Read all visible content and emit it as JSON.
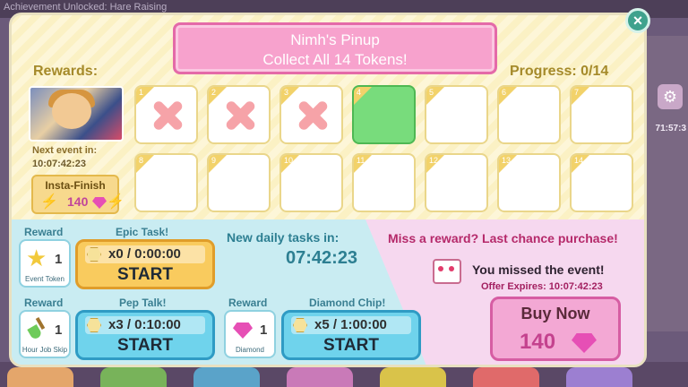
{
  "background": {
    "achievement_text": "Achievement Unlocked: Hare Raising",
    "side_timer": "71:57:3",
    "gear_icon": "gear-icon"
  },
  "modal": {
    "title_line1": "Nimh's Pinup",
    "title_line2": "Collect All 14 Tokens!",
    "close_label": "×",
    "rewards_label": "Rewards:",
    "progress_label": "Progress: 0/14",
    "next_event_label": "Next event in:",
    "next_event_timer": "10:07:42:23",
    "insta_finish_label": "Insta-Finish",
    "insta_finish_cost": "140",
    "slots": [
      {
        "num": "1",
        "state": "collected"
      },
      {
        "num": "2",
        "state": "collected"
      },
      {
        "num": "3",
        "state": "collected"
      },
      {
        "num": "4",
        "state": "current"
      },
      {
        "num": "5",
        "state": "empty"
      },
      {
        "num": "6",
        "state": "empty"
      },
      {
        "num": "7",
        "state": "empty"
      },
      {
        "num": "8",
        "state": "empty"
      },
      {
        "num": "9",
        "state": "empty"
      },
      {
        "num": "10",
        "state": "empty"
      },
      {
        "num": "11",
        "state": "empty"
      },
      {
        "num": "12",
        "state": "empty"
      },
      {
        "num": "13",
        "state": "empty"
      },
      {
        "num": "14",
        "state": "empty"
      }
    ]
  },
  "tasks": {
    "reward_label": "Reward",
    "epic": {
      "title": "Epic Task!",
      "count": "x0 / 0:00:00",
      "start": "START",
      "reward_count": "1",
      "reward_caption": "Event Token"
    },
    "pep": {
      "title": "Pep Talk!",
      "count": "x3 / 0:10:00",
      "start": "START",
      "reward_count": "1",
      "reward_caption": "Hour Job Skip"
    },
    "diamond": {
      "title": "Diamond Chip!",
      "count": "x5 / 1:00:00",
      "start": "START",
      "reward_count": "1",
      "reward_caption": "Diamond"
    },
    "daily_label": "New daily tasks in:",
    "daily_timer": "07:42:23"
  },
  "offer": {
    "title": "Miss a reward? Last chance purchase!",
    "missed_text": "You missed the event!",
    "expires_text": "Offer Expires: 10:07:42:23",
    "buy_label": "Buy Now",
    "buy_cost": "140"
  },
  "colors": {
    "accent_pink": "#f7a2cd",
    "task_orange": "#f9cb5e",
    "task_blue": "#6fd3ec",
    "slot_current": "#78dc7c",
    "close_green": "#3fa28d"
  }
}
